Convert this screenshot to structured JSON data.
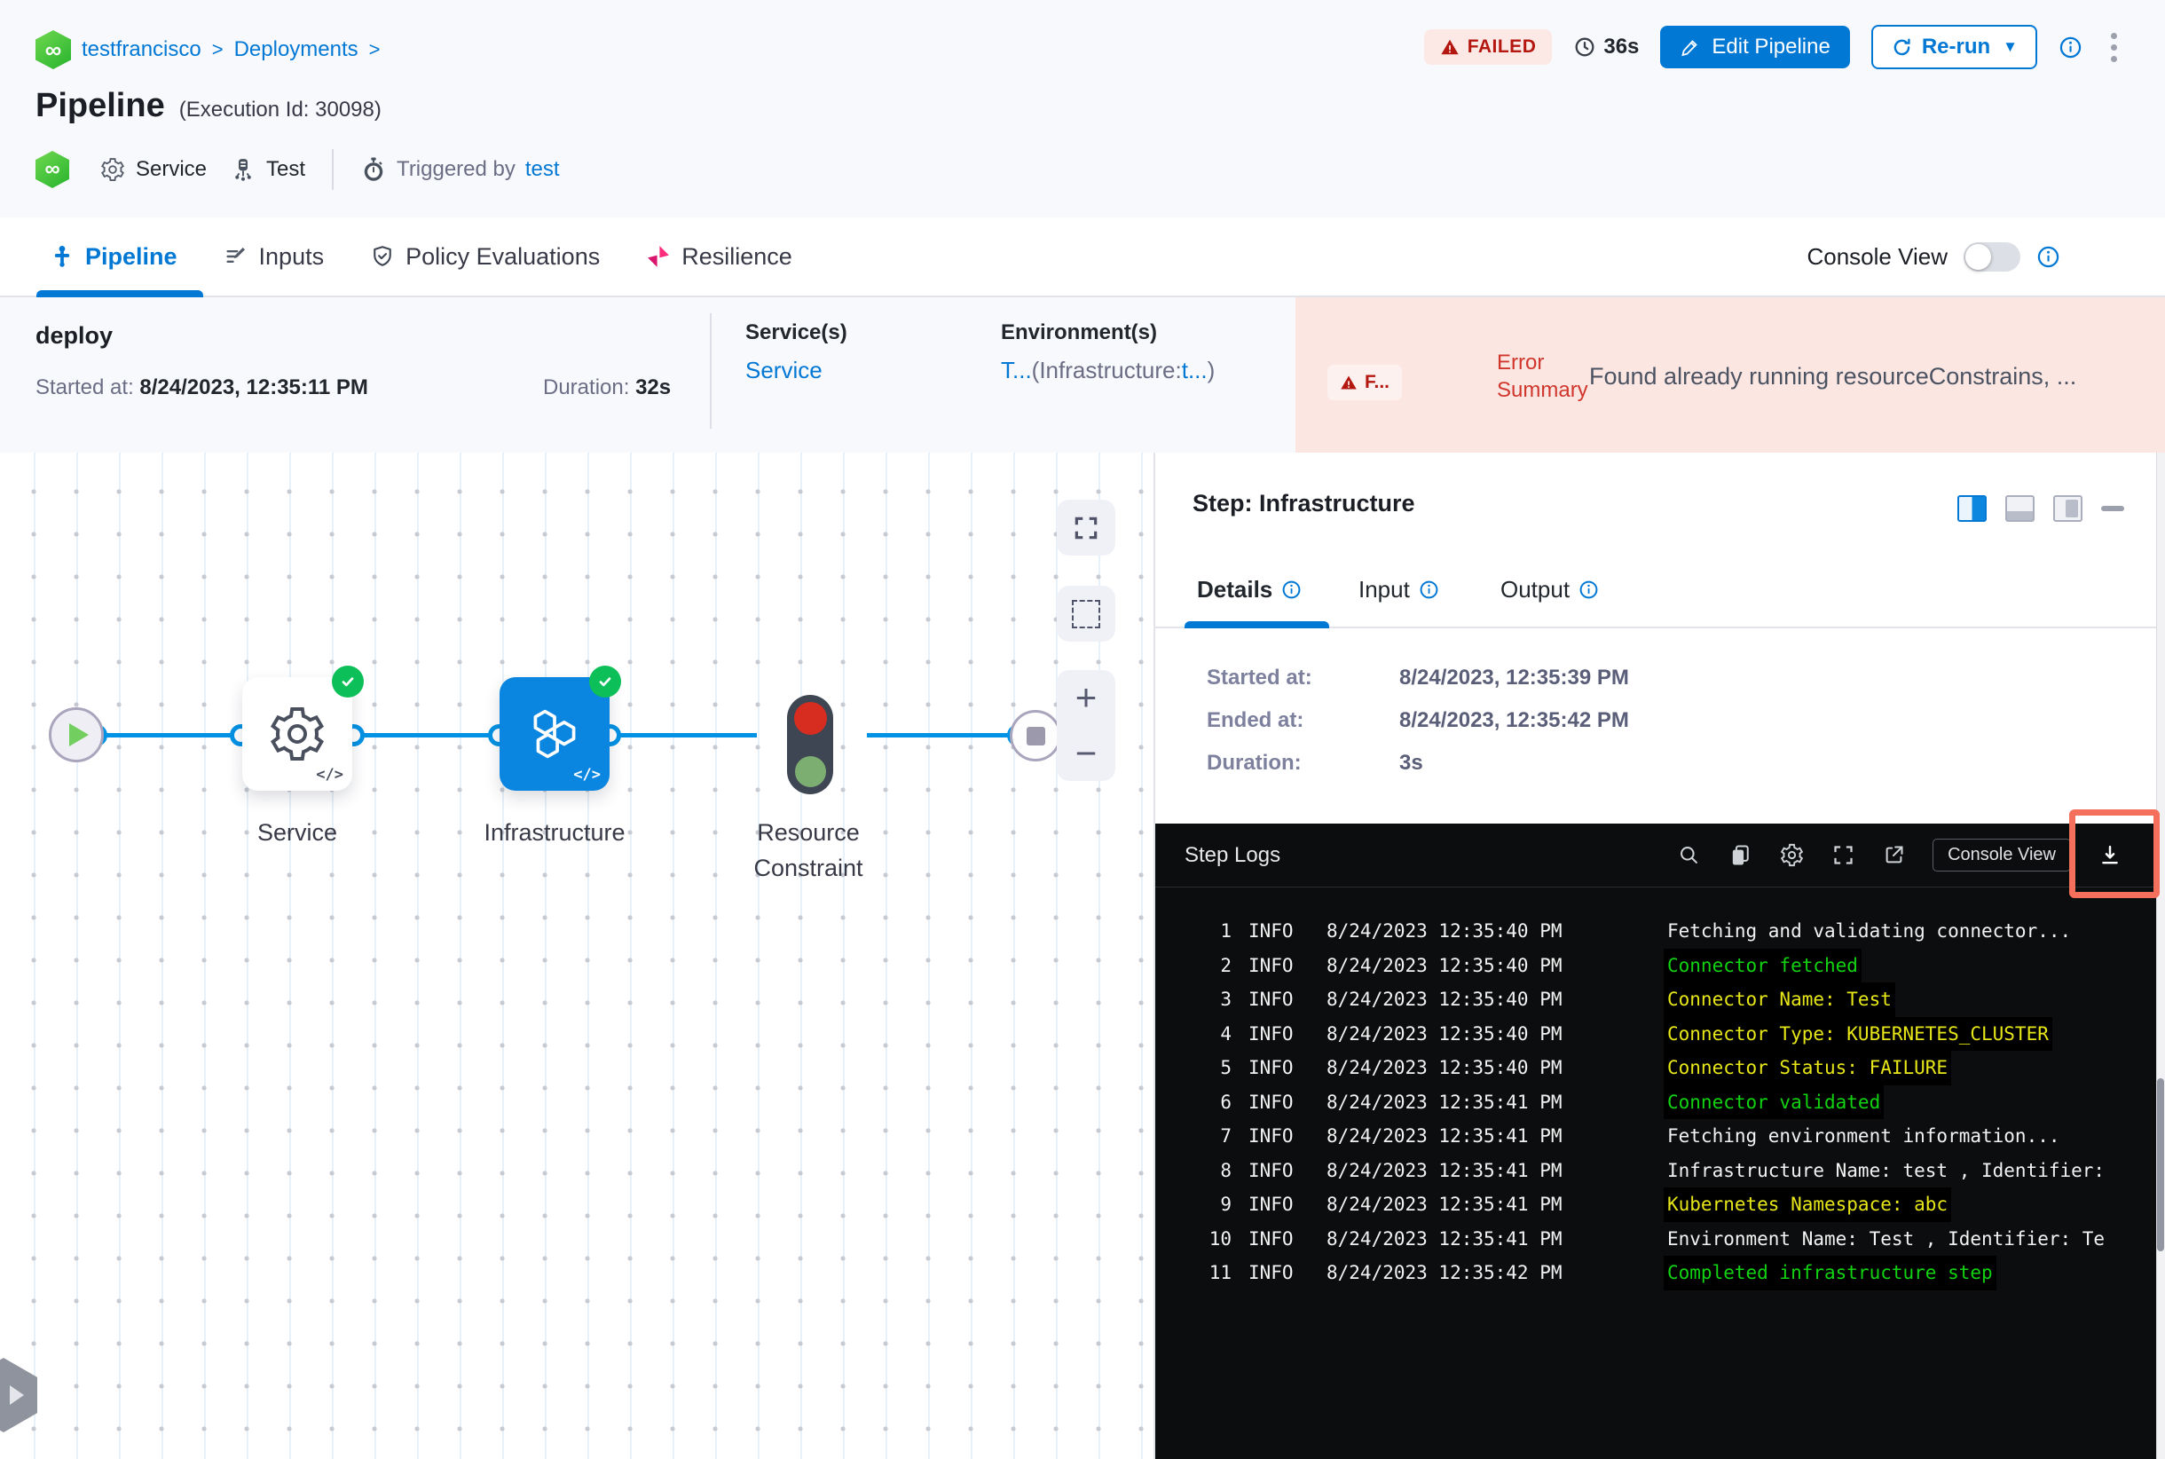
{
  "breadcrumb": {
    "project": "testfrancisco",
    "section": "Deployments",
    "separator": ">"
  },
  "header": {
    "title": "Pipeline",
    "execution_id": "(Execution Id: 30098)",
    "status_badge": "FAILED",
    "duration_chip": "36s",
    "edit_pipeline_button": "Edit Pipeline",
    "rerun_button": "Re-run",
    "service_name": "Service",
    "environment_name": "Test",
    "triggered_by_label": "Triggered by",
    "triggered_by_user": "test"
  },
  "tabs": {
    "pipeline": "Pipeline",
    "inputs": "Inputs",
    "policy_evaluations": "Policy Evaluations",
    "resilience": "Resilience",
    "console_view_label": "Console View"
  },
  "summary": {
    "stage_name": "deploy",
    "started_label": "Started at:",
    "started_value": "8/24/2023, 12:35:11 PM",
    "duration_label": "Duration:",
    "duration_value": "32s",
    "services_label": "Service(s)",
    "services_value": "Service",
    "environments_label": "Environment(s)",
    "env_value_primary": "T...",
    "env_value_paren": "(Infrastructure:",
    "env_value_link": "t...",
    "env_value_close": ")",
    "failed_chip": "F...",
    "error_summary_label_1": "Error",
    "error_summary_label_2": "Summary",
    "error_summary_text": "Found already running resourceConstrains, ..."
  },
  "graph": {
    "node_service": "Service",
    "node_infrastructure": "Infrastructure",
    "node_resource_constraint_1": "Resource",
    "node_resource_constraint_2": "Constraint",
    "code_chip": "</>",
    "zoom_in": "+",
    "zoom_out": "−"
  },
  "panel": {
    "title": "Step: Infrastructure",
    "tab_details": "Details",
    "tab_input": "Input",
    "tab_output": "Output",
    "details": [
      {
        "label": "Started at:",
        "value": "8/24/2023, 12:35:39 PM"
      },
      {
        "label": "Ended at:",
        "value": "8/24/2023, 12:35:42 PM"
      },
      {
        "label": "Duration:",
        "value": "3s"
      }
    ]
  },
  "logs": {
    "title": "Step Logs",
    "console_view_button": "Console View",
    "lines": [
      {
        "num": "1",
        "level": "INFO",
        "time": "8/24/2023 12:35:40 PM",
        "msg": "Fetching and validating connector...",
        "color": "white"
      },
      {
        "num": "2",
        "level": "INFO",
        "time": "8/24/2023 12:35:40 PM",
        "msg": "Connector fetched",
        "color": "green"
      },
      {
        "num": "3",
        "level": "INFO",
        "time": "8/24/2023 12:35:40 PM",
        "msg": "Connector Name: Test",
        "color": "yellow"
      },
      {
        "num": "4",
        "level": "INFO",
        "time": "8/24/2023 12:35:40 PM",
        "msg": "Connector Type: KUBERNETES_CLUSTER",
        "color": "yellow"
      },
      {
        "num": "5",
        "level": "INFO",
        "time": "8/24/2023 12:35:40 PM",
        "msg": "Connector Status: FAILURE",
        "color": "yellow"
      },
      {
        "num": "6",
        "level": "INFO",
        "time": "8/24/2023 12:35:41 PM",
        "msg": "Connector validated",
        "color": "green"
      },
      {
        "num": "7",
        "level": "INFO",
        "time": "8/24/2023 12:35:41 PM",
        "msg": "Fetching environment information...",
        "color": "white"
      },
      {
        "num": "8",
        "level": "INFO",
        "time": "8/24/2023 12:35:41 PM",
        "msg": "Infrastructure Name: test , Identifier:",
        "color": "white"
      },
      {
        "num": "9",
        "level": "INFO",
        "time": "8/24/2023 12:35:41 PM",
        "msg": "Kubernetes Namespace: abc",
        "color": "yellow"
      },
      {
        "num": "10",
        "level": "INFO",
        "time": "8/24/2023 12:35:41 PM",
        "msg": "Environment Name: Test , Identifier: Te",
        "color": "white"
      },
      {
        "num": "11",
        "level": "INFO",
        "time": "8/24/2023 12:35:42 PM",
        "msg": "Completed infrastructure step",
        "color": "green"
      }
    ]
  },
  "colors": {
    "primary_blue": "#0278d5",
    "failed_red": "#b41710",
    "error_bg": "#fbe6e2",
    "success_green": "#0dbf58",
    "log_green": "#12d312",
    "log_yellow": "#e6e618",
    "highlight_red": "#f4705c",
    "console_bg": "#0b0d0e"
  }
}
